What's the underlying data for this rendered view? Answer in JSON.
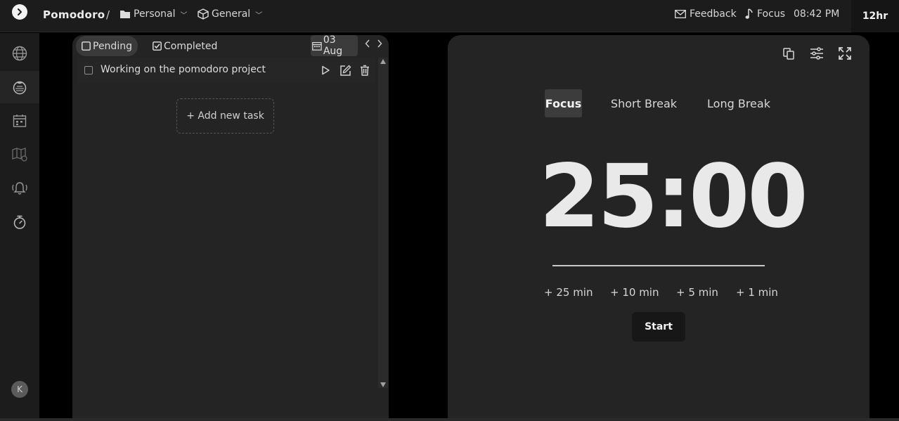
{
  "header": {
    "app_title": "Pomodoro",
    "separator": "/",
    "workspace": "Personal",
    "project": "General",
    "feedback": "Feedback",
    "focus_music": "Focus",
    "time": "08:42 PM",
    "format_toggle": "12hr"
  },
  "sidebar": {
    "items": [
      {
        "icon": "globe-icon"
      },
      {
        "icon": "pomodoro-icon",
        "active": true
      },
      {
        "icon": "calendar-icon"
      },
      {
        "icon": "map-icon"
      },
      {
        "icon": "alarm-icon"
      },
      {
        "icon": "stopwatch-icon"
      }
    ],
    "avatar_initial": "K"
  },
  "tasks": {
    "tab_pending": "Pending",
    "tab_completed": "Completed",
    "date": "03 Aug",
    "items": [
      {
        "text": "Working on the pomodoro project",
        "done": false
      }
    ],
    "add_label": "+ Add new task"
  },
  "timer": {
    "modes": [
      "Focus",
      "Short Break",
      "Long Break"
    ],
    "active_mode": "Focus",
    "display": "25:00",
    "increments": [
      "+ 25 min",
      "+ 10 min",
      "+ 5 min",
      "+ 1 min"
    ],
    "start_label": "Start"
  },
  "colors": {
    "background": "#000000",
    "panel": "#242425",
    "bar": "#1c1c1d",
    "accent": "#e9e9e9"
  }
}
